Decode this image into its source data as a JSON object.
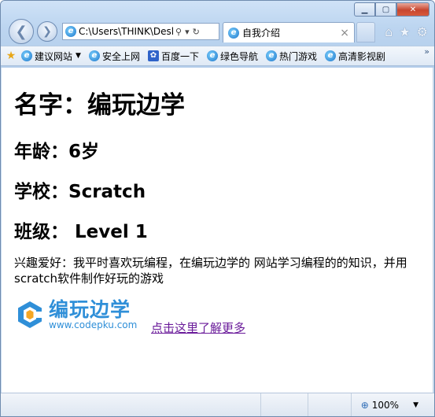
{
  "browser": {
    "address_url": "C:\\Users\\THINK\\Desl",
    "tab_title": "自我介绍",
    "favorites": [
      {
        "label": "建议网站",
        "icon": "ie-icon",
        "has_dropdown": true
      },
      {
        "label": "安全上网",
        "icon": "ie-icon"
      },
      {
        "label": "百度一下",
        "icon": "paw-icon"
      },
      {
        "label": "绿色导航",
        "icon": "ie-icon"
      },
      {
        "label": "热门游戏",
        "icon": "ie-icon"
      },
      {
        "label": "高清影视剧",
        "icon": "ie-icon"
      }
    ],
    "favorites_more": "»",
    "zoom": "100%"
  },
  "page": {
    "name_line": "名字：编玩边学",
    "age_line": "年龄：6岁",
    "school_line": "学校：Scratch",
    "class_line": "班级： Level 1",
    "hobby_text": "兴趣爱好：我平时喜欢玩编程，在编玩边学的 网站学习编程的的知识，并用scratch软件制作好玩的游戏",
    "logo_cn": "编玩边学",
    "logo_en": "www.codepku.com",
    "more_link": "点击这里了解更多"
  },
  "colors": {
    "link": "#6a1b9a",
    "logo_blue": "#2f8fd8",
    "logo_orange": "#f5a623"
  }
}
